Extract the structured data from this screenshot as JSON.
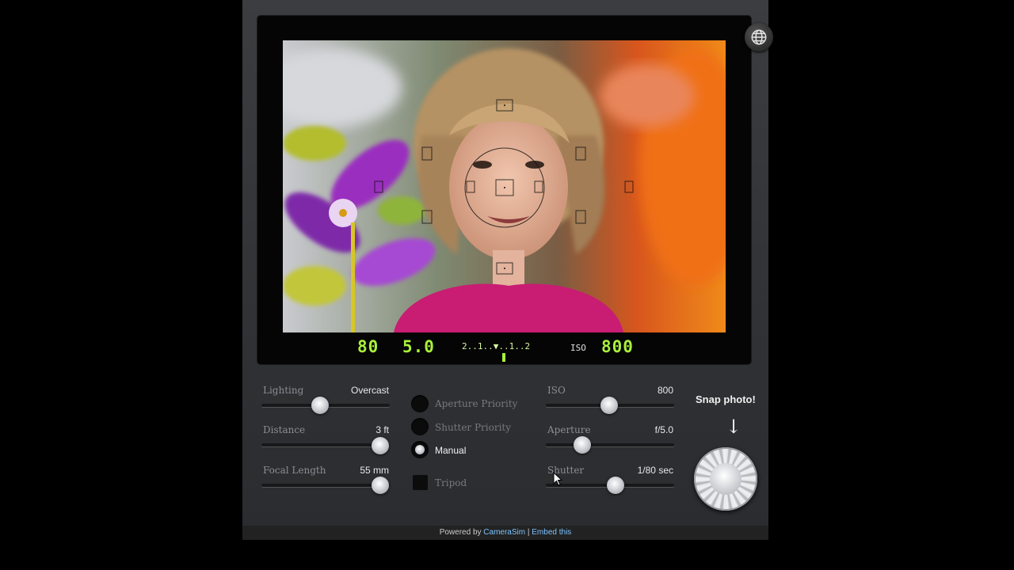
{
  "viewfinder": {
    "readout": {
      "shutter": "80",
      "aperture": "5.0",
      "meter_scale": "2..1..▼..1..2",
      "iso_label": "ISO",
      "iso": "800"
    }
  },
  "controls": {
    "lighting": {
      "label": "Lighting",
      "value": "Overcast",
      "level": 0.45
    },
    "distance": {
      "label": "Distance",
      "value": "3 ft",
      "level": 0.99
    },
    "focal_length": {
      "label": "Focal Length",
      "value": "55 mm",
      "level": 0.99
    },
    "iso": {
      "label": "ISO",
      "value": "800",
      "level": 0.49
    },
    "aperture": {
      "label": "Aperture",
      "value": "f/5.0",
      "level": 0.25
    },
    "shutter": {
      "label": "Shutter",
      "value": "1/80 sec",
      "level": 0.55
    }
  },
  "modes": [
    {
      "label": "Aperture Priority",
      "selected": false
    },
    {
      "label": "Shutter Priority",
      "selected": false
    },
    {
      "label": "Manual",
      "selected": true
    }
  ],
  "tripod": {
    "label": "Tripod",
    "checked": false
  },
  "snap": {
    "label": "Snap photo!",
    "arrow": "↓"
  },
  "footer": {
    "powered_by": "Powered by",
    "brand": "CameraSim",
    "separator": "|",
    "embed": "Embed this"
  },
  "icons": {
    "globe": "globe-icon",
    "cursor": "cursor-icon"
  }
}
